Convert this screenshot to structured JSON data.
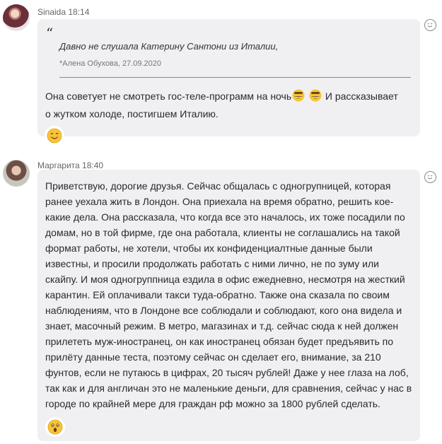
{
  "messages": [
    {
      "author": "Sinaida",
      "time": "18:14",
      "quote": {
        "text": "Давно не слушала Катерину Сантони из Италии,",
        "author_line": "*Алена Обухова, 27.09.2020"
      },
      "text_before": "Она советует не смотреть гос-теле-программ на ночь",
      "text_after": " И рассказывает о жутком холоде, постигшем Италию.",
      "inline_emoji": [
        "grinning-sweat-emoji",
        "grinning-sweat-emoji"
      ],
      "reaction": "smiling-emoji"
    },
    {
      "author": "Маргарита",
      "time": "18:40",
      "text": "Приветствую, дорогие друзья. Сейчас общалась с одногрупницей, которая ранее уехала жить в Лондон. Она приехала на время обратно, решить кое-какие дела. Она рассказала, что когда все это началось, их тоже посадили по домам, но в той фирме, где она работала, клиенты не соглашались на такой формат работы, не хотели, чтобы их конфиденциалтные данные были известны, и просили продолжать работать с ними лично, не по зуму или скайпу. И моя одногруппница ездила в офис ежедневно, несмотря на жесткий карантин. Ей оплачивали такси туда-обратно. Также она сказала по своим наблюдениям, что в Лондоне все соблюдали и соблюдают, кого она видела и знает, масочный режим. В метро, магазинах и т.д. сейчас сюда к ней должен прилететь муж-иностранец, он как иностранец обязан будет предъявить по прилёту данные теста, поэтому сейчас он сделает его, внимание, за 210 фунтов, если не путаюсь в цифрах, 20 тысяч рублей! Даже у нее глаза на лоб, так как и для англичан это не маленькие деньги, для сравнения, сейчас у нас в городе по крайней мере для граждан рф можно за 1800 рублей сделать.",
      "reaction": "surprised-emoji"
    }
  ]
}
